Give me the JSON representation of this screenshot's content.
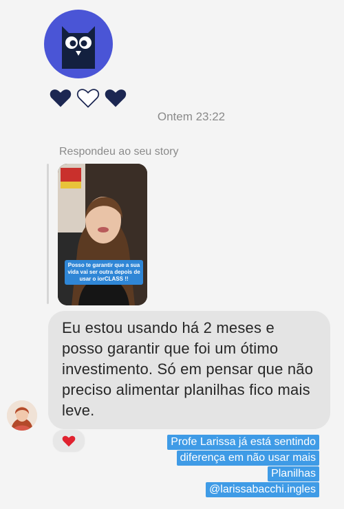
{
  "brand": {
    "logo_icon": "owl-logo-icon",
    "logo_bg": "#4a55d6"
  },
  "hearts": [
    "heart-filled-icon",
    "heart-outline-icon",
    "heart-filled-icon"
  ],
  "chat": {
    "timestamp": "Ontem 23:22",
    "replied_label": "Respondeu ao seu story",
    "story_caption": "Posso te garantir que a sua vida vai ser outra depois de usar o iorCLASS !!",
    "message": "Eu estou usando há 2 meses e posso garantir que foi um ótimo investimento. Só  em pensar que não preciso alimentar planilhas fico mais leve.",
    "reaction": "heart-reaction-icon"
  },
  "sticker": {
    "lines": [
      "Profe Larissa já está sentindo",
      "diferença em não usar mais",
      "Planilhas",
      "@larissabacchi.ingles"
    ]
  },
  "colors": {
    "bubble": "#e4e4e4",
    "sticker": "#3f9be6",
    "reaction_heart": "#e0222f"
  }
}
